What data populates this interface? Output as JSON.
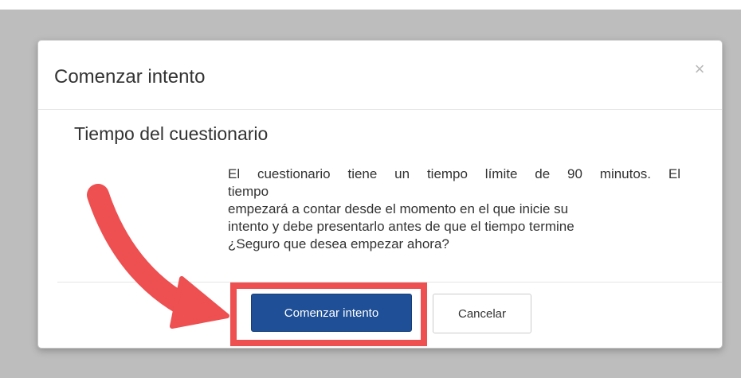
{
  "dialog": {
    "title": "Comenzar intento",
    "close_symbol": "×",
    "section_heading": "Tiempo del cuestionario",
    "message_lines": [
      "El cuestionario tiene un tiempo límite de 90 minutos. El",
      "tiempo",
      "empezará a contar desde el momento en el que inicie su",
      "intento y debe presentarlo antes de que el tiempo termine",
      "¿Seguro que desea empezar ahora?"
    ],
    "primary_button_label": "Comenzar intento",
    "secondary_button_label": "Cancelar"
  },
  "annotation": {
    "highlight_color": "#ee4f50",
    "arrow_icon": "curved-arrow-icon"
  },
  "colors": {
    "backdrop": "#bdbdbd",
    "primary_button": "#1f4f96"
  }
}
